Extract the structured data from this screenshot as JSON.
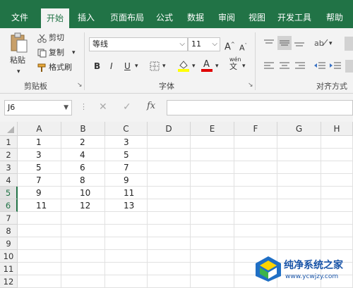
{
  "tabs": [
    "文件",
    "开始",
    "插入",
    "页面布局",
    "公式",
    "数据",
    "审阅",
    "视图",
    "开发工具",
    "帮助"
  ],
  "active_tab": "开始",
  "clipboard": {
    "paste": "粘贴",
    "cut": "剪切",
    "copy": "复制",
    "format_painter": "格式刷",
    "group_label": "剪贴板"
  },
  "font": {
    "name": "等线",
    "size": "11",
    "bold": "B",
    "italic": "I",
    "underline": "U",
    "grow": "A",
    "shrink": "A",
    "phonetic": "wén",
    "group_label": "字体"
  },
  "alignment": {
    "group_label": "对齐方式"
  },
  "formula_bar": {
    "name_box": "J6",
    "cancel": "✕",
    "enter": "✓",
    "fx": "fx",
    "formula": ""
  },
  "columns": [
    "A",
    "B",
    "C",
    "D",
    "E",
    "F",
    "G",
    "H"
  ],
  "rows": [
    "1",
    "2",
    "3",
    "4",
    "5",
    "6",
    "7",
    "8",
    "9",
    "10",
    "11",
    "12"
  ],
  "cells": [
    [
      "1",
      "2",
      "3"
    ],
    [
      "3",
      "4",
      "5"
    ],
    [
      "5",
      "6",
      "7"
    ],
    [
      "7",
      "8",
      "9"
    ],
    [
      "9",
      "10",
      "11"
    ],
    [
      "11",
      "12",
      "13"
    ]
  ],
  "selected_rows": [
    "5",
    "6"
  ],
  "watermark": {
    "title": "纯净系统之家",
    "url": "www.ycwjzy.com"
  },
  "colors": {
    "accent": "#217346",
    "font_highlight": "#ffff00",
    "font_color": "#e00000"
  }
}
